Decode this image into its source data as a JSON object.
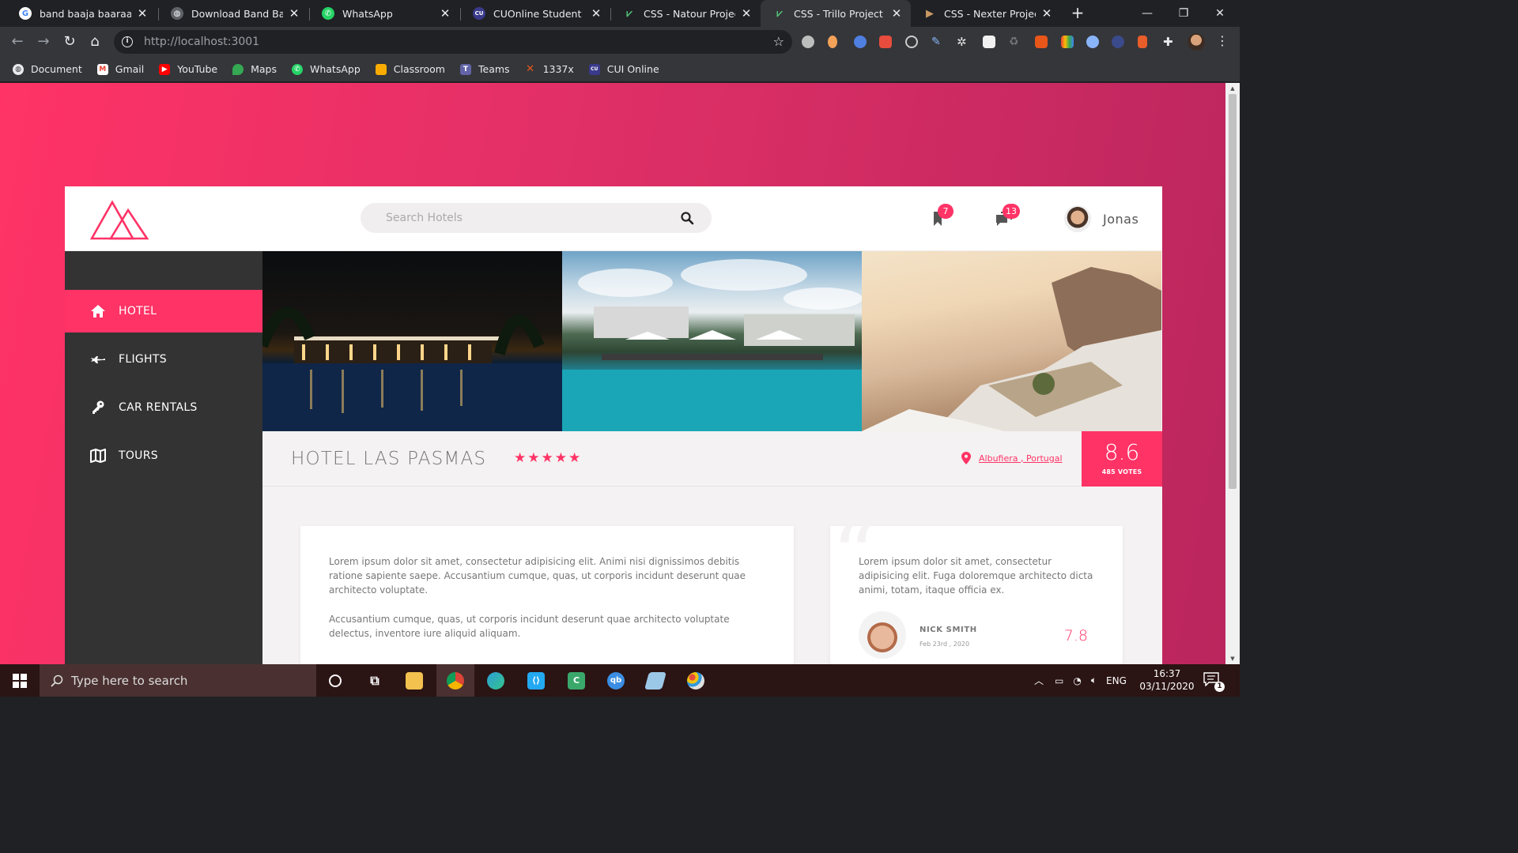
{
  "browser": {
    "tabs": [
      {
        "title": "band baaja baaraat - G",
        "icon": "google-icon",
        "color": "#ffffff"
      },
      {
        "title": "Download Band Baaja B",
        "icon": "globe-icon",
        "color": "#9aa0a6"
      },
      {
        "title": "WhatsApp",
        "icon": "whatsapp-icon",
        "color": "#25d366"
      },
      {
        "title": "CUOnline Student Port",
        "icon": "cui-icon",
        "color": "#3a3a8c"
      },
      {
        "title": "CSS - Natour Project",
        "icon": "natours-icon",
        "color": "#55c57a"
      },
      {
        "title": "CSS - Trillo Project",
        "icon": "trillo-icon",
        "color": "#55c57a",
        "active": true
      },
      {
        "title": "CSS - Nexter Project",
        "icon": "nexter-icon",
        "color": "#c69963"
      }
    ],
    "new_tab": "+",
    "window_controls": {
      "minimize": "—",
      "restore": "❐",
      "close": "✕"
    },
    "url_host": "http://localhost",
    "url_port": ":3001",
    "bookmarks": [
      {
        "label": "Document",
        "icon": "globe-icon",
        "color": "#ffffff"
      },
      {
        "label": "Gmail",
        "icon": "gmail-icon",
        "color": "#ea4335"
      },
      {
        "label": "YouTube",
        "icon": "youtube-icon",
        "color": "#ff0000"
      },
      {
        "label": "Maps",
        "icon": "maps-icon",
        "color": "#34a853"
      },
      {
        "label": "WhatsApp",
        "icon": "whatsapp-icon",
        "color": "#25d366"
      },
      {
        "label": "Classroom",
        "icon": "classroom-icon",
        "color": "#f9ab00"
      },
      {
        "label": "Teams",
        "icon": "teams-icon",
        "color": "#6264a7"
      },
      {
        "label": "1337x",
        "icon": "x-icon",
        "color": "#e8561a"
      },
      {
        "label": "CUI Online",
        "icon": "cui-icon",
        "color": "#3a3a8c"
      }
    ]
  },
  "app": {
    "search": {
      "placeholder": "Search Hotels"
    },
    "bookmarks_count": "7",
    "messages_count": "13",
    "user_name": "Jonas",
    "nav": [
      {
        "label": "HOTEL",
        "icon": "home-icon",
        "active": true
      },
      {
        "label": "FLIGHTS",
        "icon": "aircraft-icon"
      },
      {
        "label": "CAR RENTALS",
        "icon": "key-icon"
      },
      {
        "label": "TOURS",
        "icon": "map-icon"
      }
    ],
    "gallery": [
      {
        "alt": "Hotel 1"
      },
      {
        "alt": "Hotel 2"
      },
      {
        "alt": "Hotel 3"
      }
    ],
    "hotel": {
      "name": "HOTEL LAS PASMAS",
      "stars": 5,
      "stars_text": "★★★★★",
      "location": "Albufiera , Portugal",
      "rating": "8.6",
      "votes": "485 VOTES"
    },
    "description": [
      "Lorem ipsum dolor sit amet, consectetur adipisicing elit. Animi nisi dignissimos debitis ratione sapiente saepe. Accusantium cumque, quas, ut corporis incidunt deserunt quae architecto voluptate.",
      "Accusantium cumque, quas, ut corporis incidunt deserunt quae architecto voluptate delectus, inventore iure aliquid aliquam."
    ],
    "review": {
      "text": "Lorem ipsum dolor sit amet, consectetur adipisicing elit. Fuga doloremque architecto dicta animi, totam, itaque officia ex.",
      "name": "NICK SMITH",
      "date": "Feb 23rd , 2020",
      "score": "7.8"
    }
  },
  "taskbar": {
    "search_placeholder": "Type here to search",
    "apps": [
      {
        "icon": "cortana-icon",
        "color": "#ffffff"
      },
      {
        "icon": "task-view-icon",
        "color": "#ffffff"
      },
      {
        "icon": "file-explorer-icon",
        "color": "#f2c14e"
      },
      {
        "icon": "chrome-icon",
        "color": "#db4437",
        "active": true
      },
      {
        "icon": "edge-icon",
        "color": "#2b9fd9"
      },
      {
        "icon": "vscode-icon",
        "color": "#23a9f2"
      },
      {
        "icon": "cpp-ide-icon",
        "color": "#3aa86b"
      },
      {
        "icon": "qbittorrent-icon",
        "color": "#3b8ee3"
      },
      {
        "icon": "notes-icon",
        "color": "#9cc8e8"
      },
      {
        "icon": "paint-icon",
        "color": "#e0c070"
      }
    ],
    "language": "ENG",
    "time": "16:37",
    "date": "03/11/2020",
    "notification_count": "1"
  },
  "colors": {
    "accent": "#ff3366",
    "sidebar": "#333333",
    "surface": "#f4f2f2"
  }
}
